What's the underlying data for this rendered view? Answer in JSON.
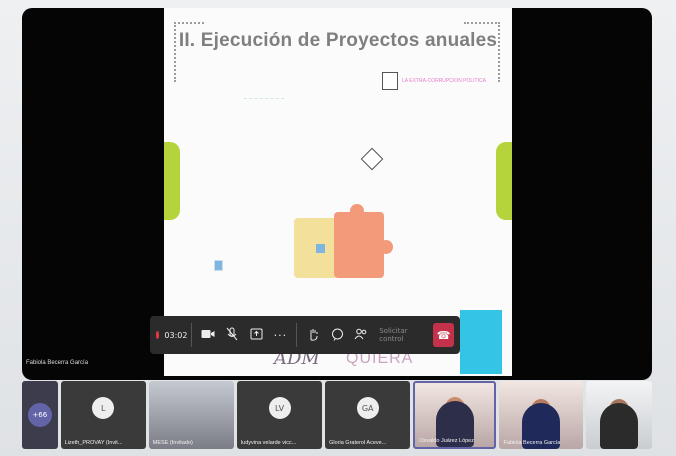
{
  "slide": {
    "title": "II. Ejecución de Proyectos anuales",
    "logo_text": "LA EXTRA-CORRUPCION POLITICA",
    "footer_left_logo": "ADM",
    "footer_right_logo": "QUIERA"
  },
  "toolbar": {
    "timer": "03:02",
    "request_control_label": "Solicitar control"
  },
  "presenter_name": "Fabiola Becerra García",
  "gallery": {
    "overflow_count": "+66",
    "tiles": [
      {
        "initials": "L",
        "name": "Lizeth_PROVAY (Invit..."
      },
      {
        "initials": "",
        "name": "MESE (Invitado)"
      },
      {
        "initials": "LV",
        "name": "ludyvina velarde vicc..."
      },
      {
        "initials": "GA",
        "name": "Gloria Graterol Aceve..."
      },
      {
        "initials": "",
        "name": "Osvaldo Juárez López"
      },
      {
        "initials": "",
        "name": "Fabiola Becerra García"
      },
      {
        "initials": "",
        "name": ""
      }
    ]
  },
  "colors": {
    "leave_red": "#c4314b",
    "record_red": "#e0393e",
    "accent_green": "#b5d43c",
    "accent_cyan": "#33c4e6"
  }
}
